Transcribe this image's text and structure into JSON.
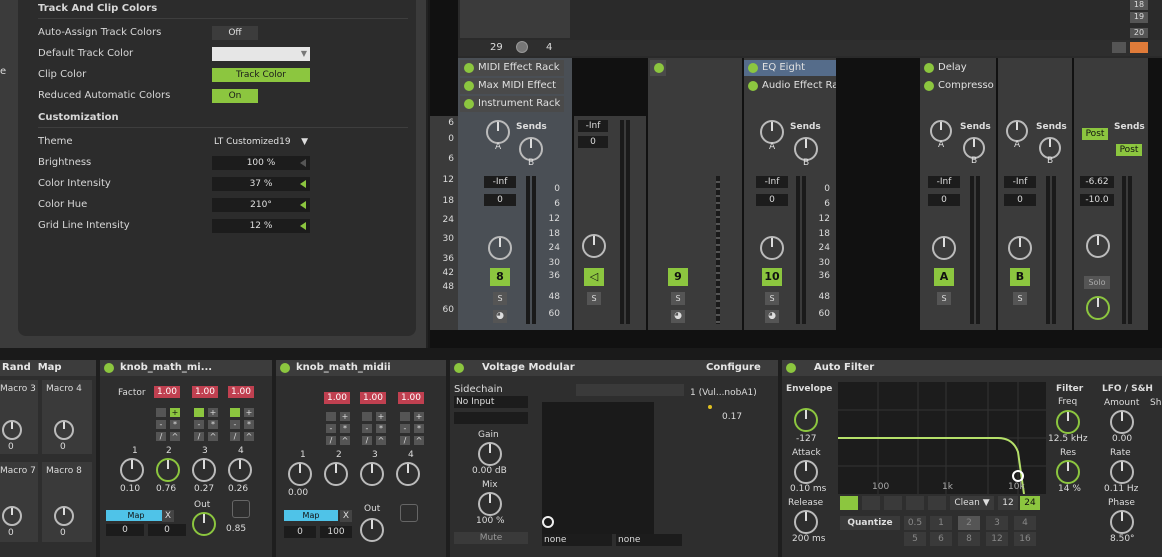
{
  "preferences": {
    "section_title": "Track And Clip Colors",
    "rows": [
      {
        "label": "Auto-Assign Track Colors",
        "value": "Off"
      },
      {
        "label": "Default Track Color",
        "value": ""
      },
      {
        "label": "Clip Color",
        "value": "Track Color"
      },
      {
        "label": "Reduced Automatic Colors",
        "value": "On"
      }
    ],
    "customization_title": "Customization",
    "custom_rows": [
      {
        "label": "Theme",
        "value": "LT Customized19"
      },
      {
        "label": "Brightness",
        "value": "100 %"
      },
      {
        "label": "Color Intensity",
        "value": "37 %"
      },
      {
        "label": "Color Hue",
        "value": "210°"
      },
      {
        "label": "Grid Line Intensity",
        "value": "12 %"
      }
    ],
    "left_edge_char": "e"
  },
  "mixer": {
    "top_bar": {
      "left_num": "29",
      "right_num": "4"
    },
    "scene_numbers": [
      "18",
      "19",
      "20"
    ],
    "left_scale": [
      "6",
      "0",
      "6",
      "12",
      "18",
      "24",
      "30",
      "36",
      "42",
      "48",
      "60"
    ],
    "meter_scale": [
      "0",
      "6",
      "12",
      "18",
      "24",
      "30",
      "36",
      "48",
      "60"
    ],
    "sends_label": "Sends",
    "send_a": "A",
    "send_b": "B",
    "tracks": [
      {
        "devices": [
          "MIDI Effect Rack",
          "Max MIDI Effect",
          "Instrument Rack"
        ],
        "vol": "-Inf",
        "pan": "0",
        "num": "8",
        "solo": "S"
      },
      {
        "devices": [],
        "vol": "-Inf",
        "pan": "0",
        "num": "",
        "solo": "S"
      },
      {
        "devices": [],
        "num": "9",
        "solo": "S"
      },
      {
        "devices": [
          "EQ Eight",
          "Audio Effect Ra"
        ],
        "vol": "-Inf",
        "pan": "0",
        "num": "10",
        "solo": "S"
      },
      {
        "devices": [
          "Delay",
          "Compresso"
        ],
        "vol": "-Inf",
        "pan": "0",
        "num": "A",
        "solo": "S"
      },
      {
        "devices": [],
        "vol": "-Inf",
        "pan": "0",
        "num": "B",
        "solo": "S"
      },
      {
        "devices": [],
        "vol": "-6.62",
        "pan": "-10.0",
        "post1": "Post",
        "post2": "Post",
        "solo": "Solo"
      }
    ]
  },
  "devices": {
    "rack": {
      "rand": "Rand",
      "map": "Map",
      "macros": [
        "Macro 3",
        "Macro 4",
        "Macro 7",
        "Macro 8"
      ],
      "macro_vals": [
        "0",
        "0",
        "0",
        "0"
      ]
    },
    "knob1": {
      "title": "knob_math_mi...",
      "factor_label": "Factor",
      "vals": [
        "1.00",
        "1.00",
        "1.00"
      ],
      "knob_nums": [
        "1",
        "2",
        "3",
        "4"
      ],
      "knob_vals": [
        "0.10",
        "0.76",
        "0.27",
        "0.26"
      ],
      "map": "Map",
      "x": "X",
      "map_vals": [
        "0",
        "0"
      ],
      "out_label": "Out",
      "out_val": "0.85",
      "ops": [
        "+",
        "-",
        "/",
        "*",
        "^"
      ]
    },
    "knob2": {
      "title": "knob_math_midii",
      "vals": [
        "1.00",
        "1.00",
        "1.00"
      ],
      "knob_nums": [
        "1",
        "2",
        "3",
        "4"
      ],
      "knob_val": "0.00",
      "map": "Map",
      "x": "X",
      "map_vals": [
        "0",
        "100"
      ],
      "out_label": "Out"
    },
    "voltage": {
      "title": "Voltage Modular",
      "configure": "Configure",
      "sidechain": "Sidechain",
      "no_input": "No Input",
      "gain": "Gain",
      "gain_val": "0.00 dB",
      "mix": "Mix",
      "mix_val": "100 %",
      "mute": "Mute",
      "mod_name": "1 (Vul...nobA1)",
      "mod_val": "0.17",
      "none1": "none",
      "none2": "none"
    },
    "autofilter": {
      "title": "Auto Filter",
      "envelope": "Envelope",
      "env_val": "-127",
      "attack": "Attack",
      "attack_val": "0.10 ms",
      "release": "Release",
      "release_val": "200 ms",
      "freq_labels": [
        "100",
        "1k",
        "10k"
      ],
      "clean": "Clean",
      "n12": "12",
      "n24": "24",
      "quantize": "Quantize",
      "q_row1": [
        "0.5",
        "1",
        "2",
        "3",
        "4"
      ],
      "q_row2": [
        "5",
        "6",
        "8",
        "12",
        "16"
      ],
      "filter": "Filter",
      "freq": "Freq",
      "freq_val": "12.5 kHz",
      "res": "Res",
      "res_val": "14 %",
      "lfo": "LFO / S&H",
      "amount": "Amount",
      "amount_val": "0.00",
      "rate": "Rate",
      "rate_val": "0.11 Hz",
      "phase": "Phase",
      "phase_val": "8.50°",
      "sh": "Sh"
    }
  },
  "colors": {
    "accent": "#8cc63f",
    "blue": "#4fc3e8",
    "red": "#c04050"
  }
}
